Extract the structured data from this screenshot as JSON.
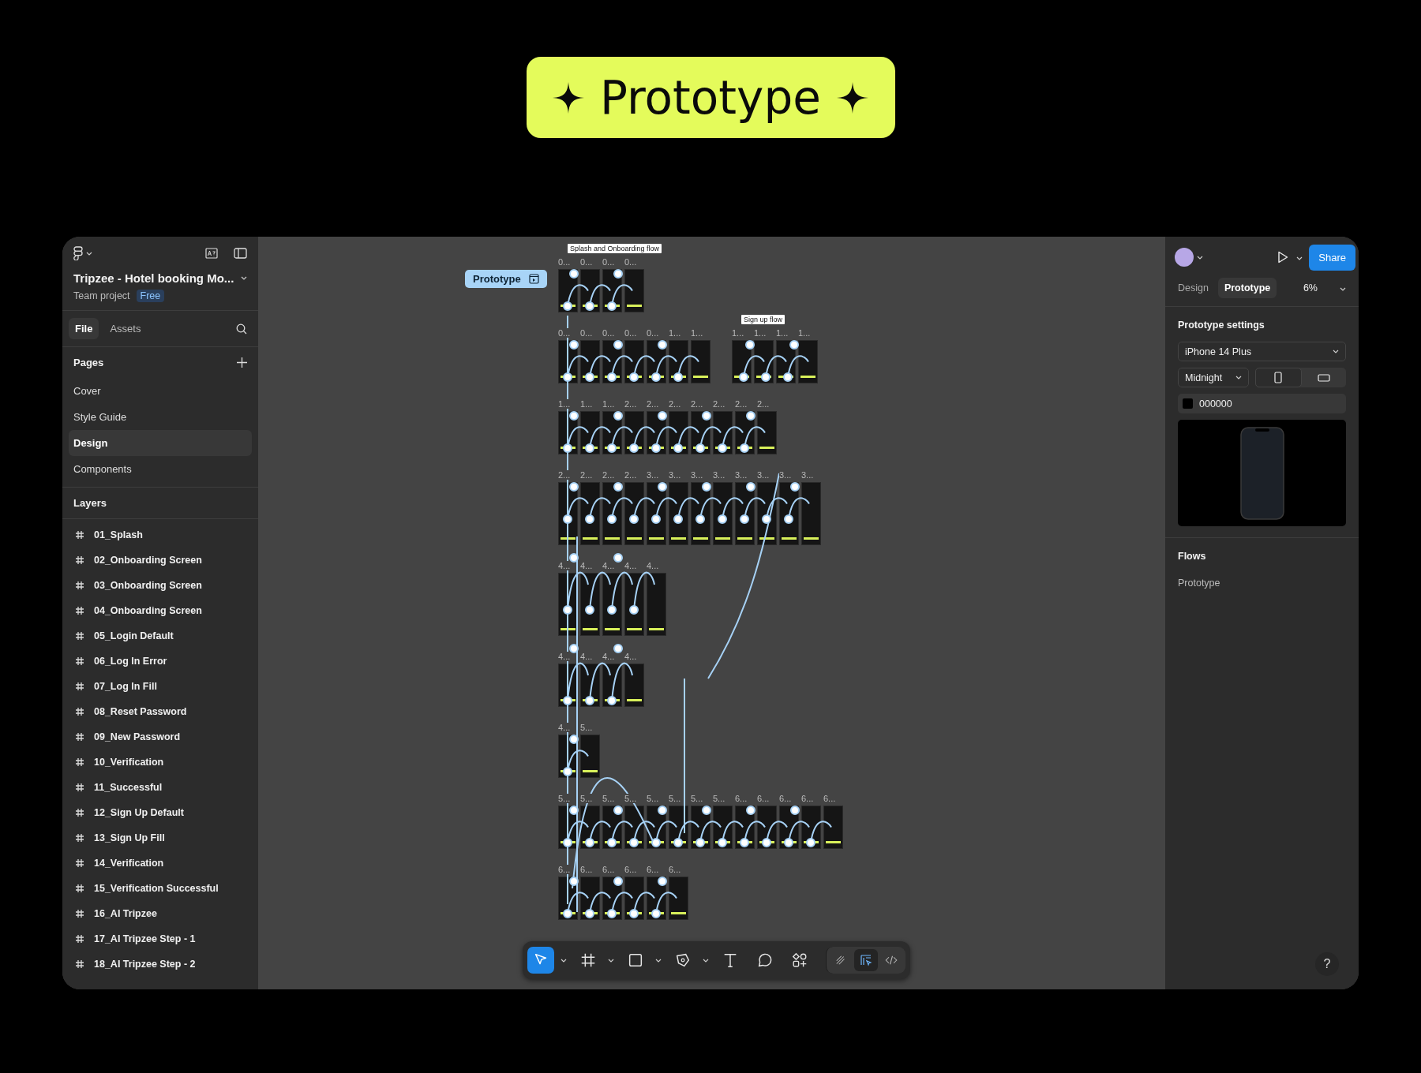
{
  "headline": {
    "text": "Prototype"
  },
  "file": {
    "name": "Tripzee - Hotel booking Mo...",
    "project": "Team project",
    "plan_badge": "Free"
  },
  "panel_tabs": [
    {
      "label": "File",
      "selected": true
    },
    {
      "label": "Assets",
      "selected": false
    }
  ],
  "pages": {
    "title": "Pages",
    "items": [
      {
        "label": "Cover",
        "selected": false
      },
      {
        "label": "Style Guide",
        "selected": false
      },
      {
        "label": "Design",
        "selected": true
      },
      {
        "label": "Components",
        "selected": false
      }
    ]
  },
  "layers": {
    "title": "Layers",
    "items": [
      "01_Splash",
      "02_Onboarding Screen",
      "03_Onboarding Screen",
      "04_Onboarding Screen",
      "05_Login Default",
      "06_Log In Error",
      "07_Log In Fill",
      "08_Reset Password",
      "09_New Password",
      "10_Verification",
      "11_Successful",
      "12_Sign Up Default",
      "13_Sign Up Fill",
      "14_Verification",
      "15_Verification Successful",
      "16_AI Tripzee",
      "17_AI Tripzee Step - 1",
      "18_AI Tripzee Step - 2"
    ]
  },
  "canvas": {
    "start_badge": "Prototype",
    "rows": [
      {
        "groups": [
          {
            "flow_label": "Splash and Onboarding flow",
            "frames": [
              {
                "label": "0..."
              },
              {
                "label": "0..."
              },
              {
                "label": "0..."
              },
              {
                "label": "0..."
              }
            ]
          }
        ]
      },
      {
        "groups": [
          {
            "frames": [
              {
                "label": "0..."
              },
              {
                "label": "0..."
              },
              {
                "label": "0..."
              },
              {
                "label": "0..."
              },
              {
                "label": "0..."
              },
              {
                "label": "1..."
              },
              {
                "label": "1..."
              }
            ]
          },
          {
            "flow_label": "Sign up flow",
            "frames": [
              {
                "label": "1..."
              },
              {
                "label": "1..."
              },
              {
                "label": "1..."
              },
              {
                "label": "1..."
              }
            ]
          }
        ]
      },
      {
        "groups": [
          {
            "frames": [
              {
                "label": "1..."
              },
              {
                "label": "1..."
              },
              {
                "label": "1..."
              },
              {
                "label": "2..."
              },
              {
                "label": "2..."
              },
              {
                "label": "2..."
              },
              {
                "label": "2..."
              },
              {
                "label": "2..."
              },
              {
                "label": "2..."
              },
              {
                "label": "2..."
              }
            ]
          }
        ]
      },
      {
        "groups": [
          {
            "frames": [
              {
                "label": "2..."
              },
              {
                "label": "2..."
              },
              {
                "label": "2..."
              },
              {
                "label": "2..."
              },
              {
                "label": "3..."
              },
              {
                "label": "3..."
              },
              {
                "label": "3..."
              },
              {
                "label": "3..."
              },
              {
                "label": "3..."
              },
              {
                "label": "3..."
              },
              {
                "label": "3..."
              },
              {
                "label": "3..."
              }
            ]
          }
        ]
      },
      {
        "groups": [
          {
            "frames": [
              {
                "label": "4..."
              },
              {
                "label": "4..."
              },
              {
                "label": "4..."
              },
              {
                "label": "4..."
              },
              {
                "label": "4..."
              }
            ]
          }
        ]
      },
      {
        "groups": [
          {
            "frames": [
              {
                "label": "4..."
              },
              {
                "label": "4..."
              },
              {
                "label": "4..."
              },
              {
                "label": "4..."
              }
            ]
          }
        ]
      },
      {
        "groups": [
          {
            "frames": [
              {
                "label": "4..."
              },
              {
                "label": "5..."
              }
            ]
          }
        ]
      },
      {
        "groups": [
          {
            "frames": [
              {
                "label": "5..."
              },
              {
                "label": "5..."
              },
              {
                "label": "5..."
              },
              {
                "label": "5..."
              },
              {
                "label": "5..."
              },
              {
                "label": "5..."
              },
              {
                "label": "5..."
              },
              {
                "label": "5..."
              },
              {
                "label": "6..."
              },
              {
                "label": "6..."
              },
              {
                "label": "6..."
              },
              {
                "label": "6..."
              },
              {
                "label": "6..."
              }
            ]
          }
        ]
      },
      {
        "groups": [
          {
            "frames": [
              {
                "label": "6..."
              },
              {
                "label": "6..."
              },
              {
                "label": "6..."
              },
              {
                "label": "6..."
              },
              {
                "label": "6..."
              },
              {
                "label": "6..."
              }
            ]
          }
        ]
      }
    ]
  },
  "toolbar": {
    "tools": [
      {
        "kind": "move",
        "selected": true
      },
      {
        "kind": "frame",
        "selected": false
      },
      {
        "kind": "rectangle",
        "selected": false
      },
      {
        "kind": "pen",
        "selected": false
      },
      {
        "kind": "text",
        "selected": false
      },
      {
        "kind": "comment",
        "selected": false
      },
      {
        "kind": "actions",
        "selected": false
      }
    ],
    "modes": [
      {
        "kind": "draw",
        "selected": false
      },
      {
        "kind": "design",
        "selected": true
      },
      {
        "kind": "dev",
        "selected": false
      }
    ]
  },
  "right_panel": {
    "share": "Share",
    "tabs": [
      {
        "label": "Design",
        "selected": false
      },
      {
        "label": "Prototype",
        "selected": true
      }
    ],
    "zoom": "6%",
    "settings_title": "Prototype settings",
    "device": "iPhone 14 Plus",
    "model": "Midnight",
    "orientations": [
      {
        "kind": "portrait",
        "selected": true
      },
      {
        "kind": "landscape",
        "selected": false
      }
    ],
    "background_hex": "000000",
    "flows_title": "Flows",
    "flows": [
      "Prototype"
    ]
  },
  "help": "?"
}
